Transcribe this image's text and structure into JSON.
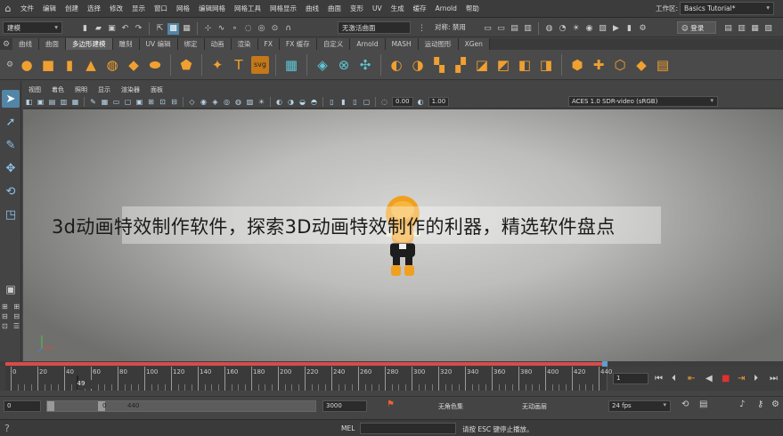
{
  "menubar": {
    "items": [
      "文件",
      "编辑",
      "创建",
      "选择",
      "修改",
      "显示",
      "窗口",
      "网格",
      "编辑网格",
      "网格工具",
      "网格显示",
      "曲线",
      "曲面",
      "变形",
      "UV",
      "生成",
      "缓存",
      "Arnold",
      "帮助"
    ],
    "workspace_label": "工作区:",
    "workspace_value": "Basics Tutorial*"
  },
  "statusline": {
    "mode": "建模",
    "live_surface": "无激活曲面",
    "symmetry": "对称: 禁用",
    "login": "登录"
  },
  "shelf_tabs": [
    "曲线",
    "曲面",
    "多边形建模",
    "雕刻",
    "UV 编辑",
    "绑定",
    "动画",
    "渲染",
    "FX",
    "FX 缓存",
    "自定义",
    "Arnold",
    "MASH",
    "运动图形",
    "XGen"
  ],
  "active_shelf_tab": "多边形建模",
  "shelf_extra_label": "svg",
  "panel_menu": [
    "视图",
    "着色",
    "照明",
    "显示",
    "渲染器",
    "面板"
  ],
  "panel_toolbar": {
    "exposure": "0.00",
    "gamma": "1.00",
    "color_space": "ACES 1.0 SDR-video (sRGB)"
  },
  "caption": "3d动画特效制作软件，探索3D动画特效制作的利器，精选软件盘点",
  "timeline": {
    "ticks": [
      0,
      20,
      40,
      60,
      80,
      100,
      120,
      140,
      160,
      180,
      200,
      220,
      240,
      260,
      280,
      300,
      320,
      340,
      360,
      380,
      400,
      420,
      440
    ],
    "current_frame": "49",
    "end_field": "1"
  },
  "range": {
    "start": "0",
    "inner_start": "0",
    "inner_end": "440",
    "end": "3000",
    "character_set": "无角色集",
    "anim_layer": "无动画层",
    "fps": "24 fps"
  },
  "command": {
    "lang": "MEL",
    "help": "请按 ESC 键停止播放。"
  },
  "colors": {
    "accent_orange": "#f0a030",
    "accent_teal": "#5fc6d6",
    "timeline_red": "#d84b4b",
    "maya_blue": "#1c8fc5"
  },
  "logo_letter": "M"
}
